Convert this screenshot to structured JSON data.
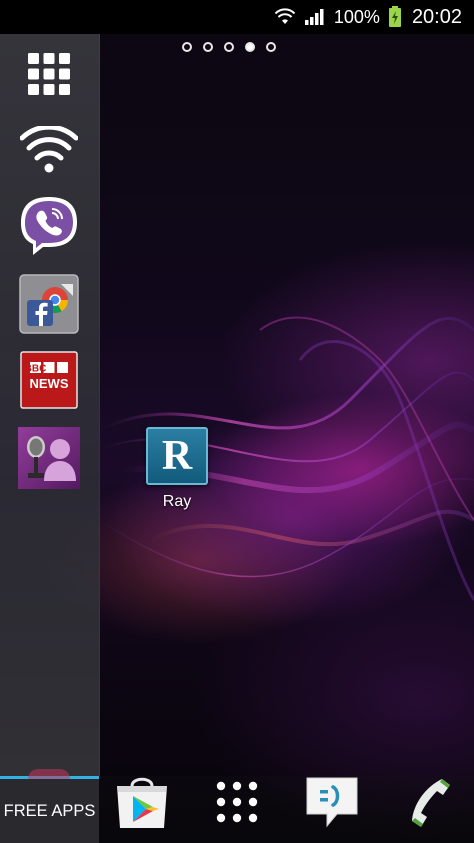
{
  "status_bar": {
    "battery_percent": "100%",
    "clock": "20:02",
    "icons": [
      "wifi-icon",
      "signal-icon",
      "battery-charging-icon"
    ]
  },
  "home": {
    "page_count": 5,
    "active_page": 4,
    "desktop_apps": [
      {
        "label": "Ray",
        "icon_letter": "R",
        "icon": "ray-app-icon"
      }
    ]
  },
  "side_dock": {
    "items": [
      {
        "icon": "app-drawer-grid-icon"
      },
      {
        "icon": "wifi-toggle-icon"
      },
      {
        "icon": "viber-app-icon"
      },
      {
        "icon": "facebook-app-icon"
      },
      {
        "icon": "bbc-news-app-icon",
        "lines": [
          "BBC",
          "NEWS"
        ]
      },
      {
        "icon": "voice-contact-app-icon"
      }
    ]
  },
  "bottom_bar": {
    "free_apps_label": "FREE APPS",
    "items": [
      {
        "icon": "play-store-icon"
      },
      {
        "icon": "app-drawer-grid-icon"
      },
      {
        "icon": "messaging-icon"
      },
      {
        "icon": "phone-icon"
      }
    ]
  },
  "colors": {
    "accent": "#34b2e4",
    "viber": "#7b4fa3",
    "bbc_red": "#bb1919",
    "ray_tile": "#1e6e92"
  }
}
